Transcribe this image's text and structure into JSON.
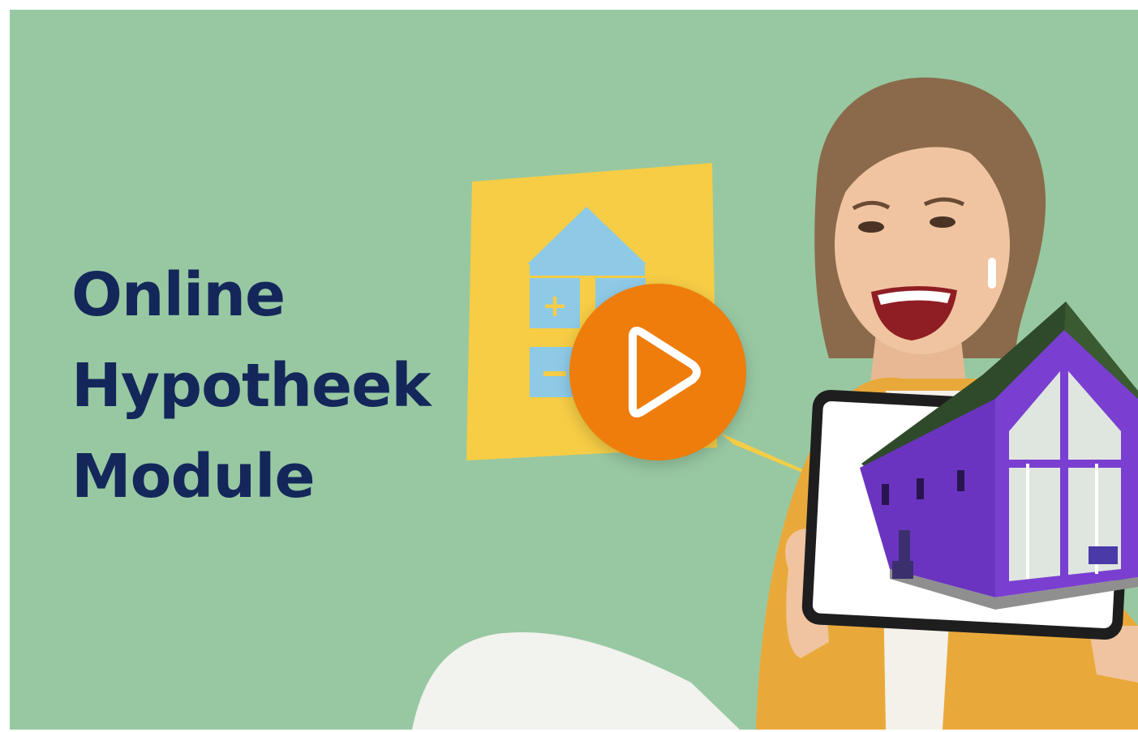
{
  "video": {
    "title_lines": [
      "Online",
      "Hypotheek",
      "Module"
    ],
    "play_button_label": "Play video"
  },
  "colors": {
    "background": "#98c8a2",
    "title": "#14275a",
    "play_button": "#ee7d0b",
    "note_yellow": "#f6cd45",
    "calculator_blue": "#8ecae6",
    "house_purple": "#7a3fd1",
    "jacket_mustard": "#e9a93a"
  },
  "icons": {
    "play": "play-icon",
    "calculator": "calculator-house-icon",
    "tablet": "tablet-icon",
    "house": "house-icon"
  }
}
